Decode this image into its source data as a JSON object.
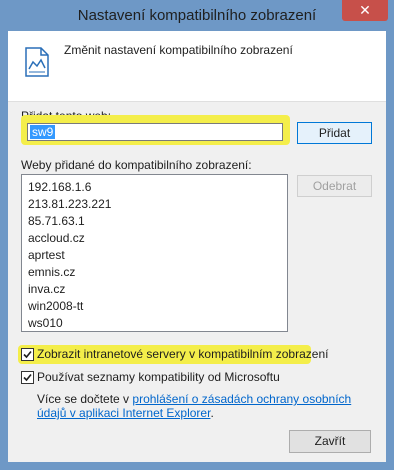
{
  "window": {
    "title": "Nastavení kompatibilního zobrazení",
    "close_label": "✕"
  },
  "header": {
    "text": "Změnit nastavení kompatibilního zobrazení"
  },
  "add_site": {
    "label": "Přidat tento web:",
    "value": "sw9",
    "add_button": "Přidat"
  },
  "sites_list": {
    "label": "Weby přidané do kompatibilního zobrazení:",
    "items": [
      "192.168.1.6",
      "213.81.223.221",
      "85.71.63.1",
      "accloud.cz",
      "aprtest",
      "emnis.cz",
      "inva.cz",
      "win2008-tt",
      "ws010"
    ],
    "remove_button": "Odebrat"
  },
  "options": {
    "intranet_label": "Zobrazit intranetové servery v kompatibilním zobrazení",
    "intranet_checked": true,
    "microsoft_lists_label": "Používat seznamy kompatibility od Microsoftu",
    "microsoft_lists_checked": true
  },
  "privacy": {
    "prefix": "Více se dočtete v",
    "link_text": "prohlášení o zásadách ochrany osobních údajů v aplikaci Internet Explorer",
    "suffix": "."
  },
  "footer": {
    "close_button": "Zavřít"
  }
}
